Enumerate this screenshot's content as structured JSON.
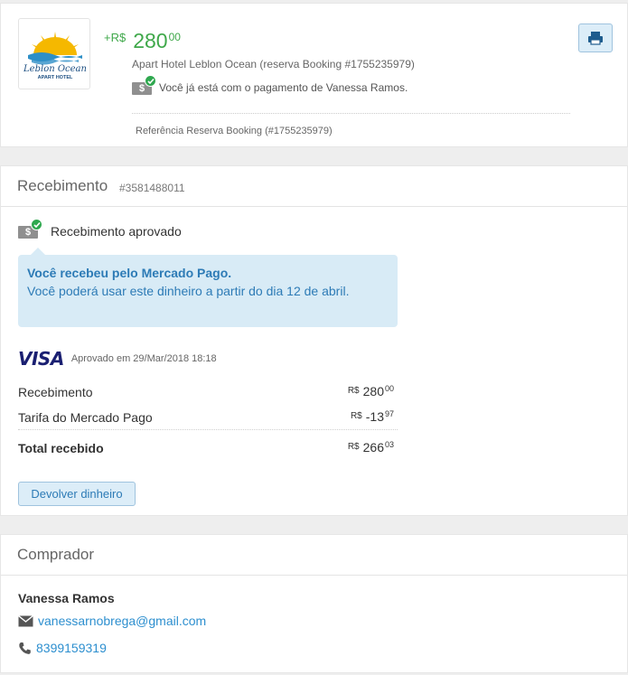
{
  "top": {
    "logo": {
      "brand_line1": "Leblon Ocean",
      "brand_line2": "APART HOTEL"
    },
    "amount": {
      "prefix": "+R$",
      "whole": "280",
      "cents": "00",
      "color": "#3fa84a"
    },
    "description": "Apart Hotel Leblon Ocean (reserva Booking #1755235979)",
    "payment_note": "Você já está com o pagamento de Vanessa Ramos.",
    "reference": "Referência Reserva Booking (#1755235979)",
    "print_icon": "printer-icon"
  },
  "receipt": {
    "title": "Recebimento",
    "id": "#3581488011",
    "status": "Recebimento aprovado",
    "info_strong": "Você recebeu pelo Mercado Pago.",
    "info_text": "Você poderá usar este dinheiro a partir do dia 12 de abril.",
    "card_brand": "VISA",
    "approved_at": "Aprovado em 29/Mar/2018 18:18",
    "lines": [
      {
        "label": "Recebimento",
        "currency": "R$",
        "whole": "280",
        "cents": "00"
      },
      {
        "label": "Tarifa do Mercado Pago",
        "currency": "R$",
        "whole": "-13",
        "cents": "97"
      },
      {
        "label": "Total recebido",
        "currency": "R$",
        "whole": "266",
        "cents": "03"
      }
    ],
    "return_button": "Devolver dinheiro"
  },
  "buyer": {
    "title": "Comprador",
    "name": "Vanessa Ramos",
    "email": "vanessarnobrega@gmail.com",
    "phone": "8399159319"
  },
  "colors": {
    "accent_blue": "#2d7bb6",
    "link_blue": "#2d8fcf",
    "success_green": "#2fa84f",
    "info_bg": "#d8ebf6"
  }
}
